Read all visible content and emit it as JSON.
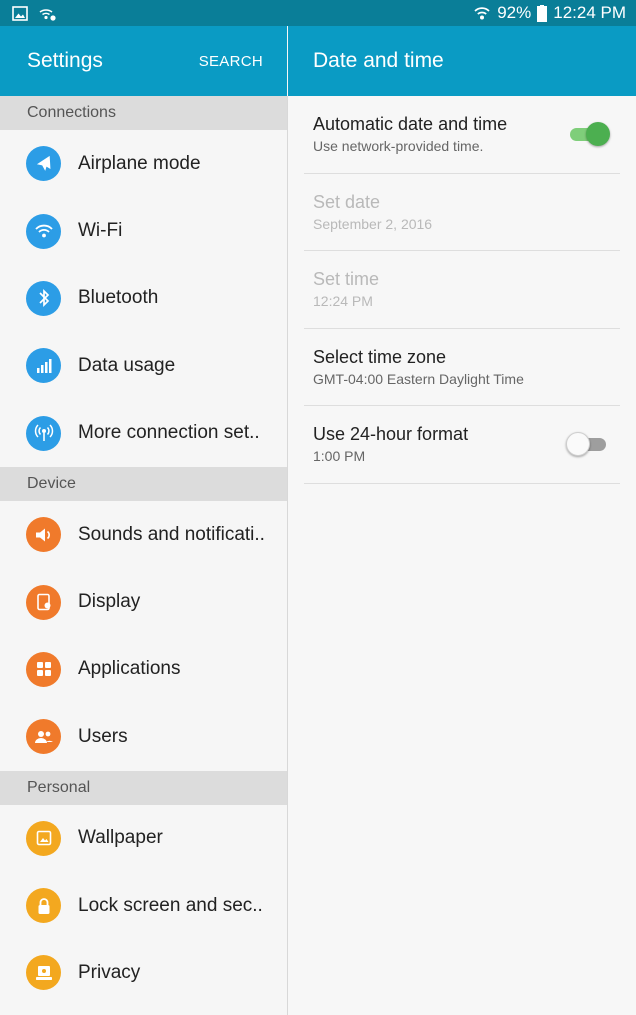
{
  "status_bar": {
    "battery": "92%",
    "time": "12:24 PM",
    "icons": [
      "picture-notification-icon",
      "wifi-notification-icon",
      "wifi-signal-icon",
      "battery-icon"
    ]
  },
  "left_header": {
    "title": "Settings",
    "search_label": "SEARCH"
  },
  "right_header": {
    "title": "Date and time"
  },
  "sections": [
    {
      "header": "Connections",
      "items": [
        {
          "label": "Airplane mode",
          "icon": "airplane-icon",
          "color": "#2c9de6"
        },
        {
          "label": "Wi-Fi",
          "icon": "wifi-icon",
          "color": "#2c9de6"
        },
        {
          "label": "Bluetooth",
          "icon": "bluetooth-icon",
          "color": "#2c9de6"
        },
        {
          "label": "Data usage",
          "icon": "data-usage-icon",
          "color": "#2c9de6"
        },
        {
          "label": "More connection set..",
          "icon": "connection-icon",
          "color": "#2c9de6"
        }
      ]
    },
    {
      "header": "Device",
      "items": [
        {
          "label": "Sounds and notificati..",
          "icon": "sound-icon",
          "color": "#f07a2b"
        },
        {
          "label": "Display",
          "icon": "display-icon",
          "color": "#f07a2b"
        },
        {
          "label": "Applications",
          "icon": "apps-icon",
          "color": "#f07a2b"
        },
        {
          "label": "Users",
          "icon": "users-icon",
          "color": "#f07a2b"
        }
      ]
    },
    {
      "header": "Personal",
      "items": [
        {
          "label": "Wallpaper",
          "icon": "wallpaper-icon",
          "color": "#f3a81f"
        },
        {
          "label": "Lock screen and sec..",
          "icon": "lock-icon",
          "color": "#f3a81f"
        },
        {
          "label": "Privacy",
          "icon": "privacy-icon",
          "color": "#f3a81f"
        }
      ]
    }
  ],
  "prefs": [
    {
      "title": "Automatic date and time",
      "subtitle": "Use network-provided time.",
      "toggle": "on",
      "disabled": false
    },
    {
      "title": "Set date",
      "subtitle": "September 2, 2016",
      "toggle": null,
      "disabled": true
    },
    {
      "title": "Set time",
      "subtitle": "12:24 PM",
      "toggle": null,
      "disabled": true
    },
    {
      "title": "Select time zone",
      "subtitle": "GMT-04:00 Eastern Daylight Time",
      "toggle": null,
      "disabled": false
    },
    {
      "title": "Use 24-hour format",
      "subtitle": "1:00 PM",
      "toggle": "off",
      "disabled": false
    }
  ],
  "colors": {
    "status_bar": "#0a7e98",
    "app_bar": "#0a9bc4",
    "connections_icon": "#2c9de6",
    "device_icon": "#f07a2b",
    "personal_icon": "#f3a81f",
    "toggle_on": "#4caf50"
  }
}
